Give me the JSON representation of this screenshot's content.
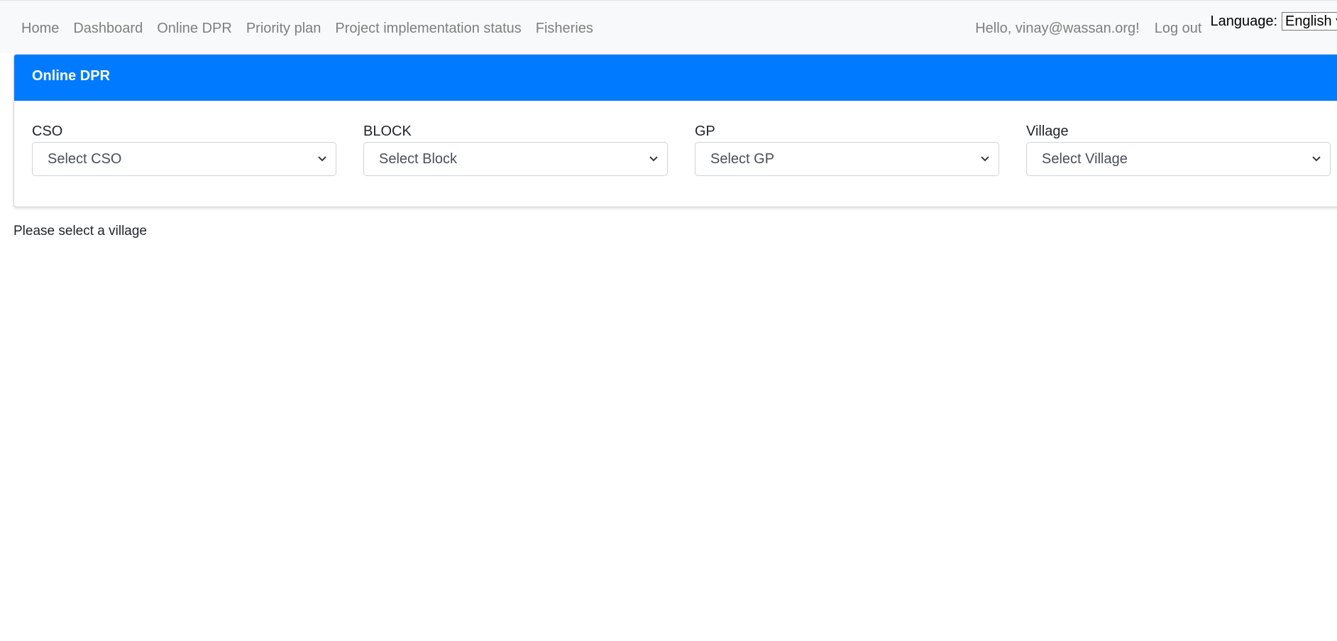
{
  "nav": {
    "links": [
      "Home",
      "Dashboard",
      "Online DPR",
      "Priority plan",
      "Project implementation status",
      "Fisheries"
    ],
    "greeting": "Hello, vinay@wassan.org!",
    "logout": "Log out",
    "language_label": "Language:",
    "language_value": "English ▾"
  },
  "card": {
    "title": "Online DPR",
    "filters": [
      {
        "label": "CSO",
        "placeholder": "Select CSO"
      },
      {
        "label": "BLOCK",
        "placeholder": "Select Block"
      },
      {
        "label": "GP",
        "placeholder": "Select GP"
      },
      {
        "label": "Village",
        "placeholder": "Select Village"
      }
    ]
  },
  "status_message": "Please select a village",
  "colors": {
    "header_bg": "#007bff",
    "navbar_bg": "#f8f9fa"
  }
}
